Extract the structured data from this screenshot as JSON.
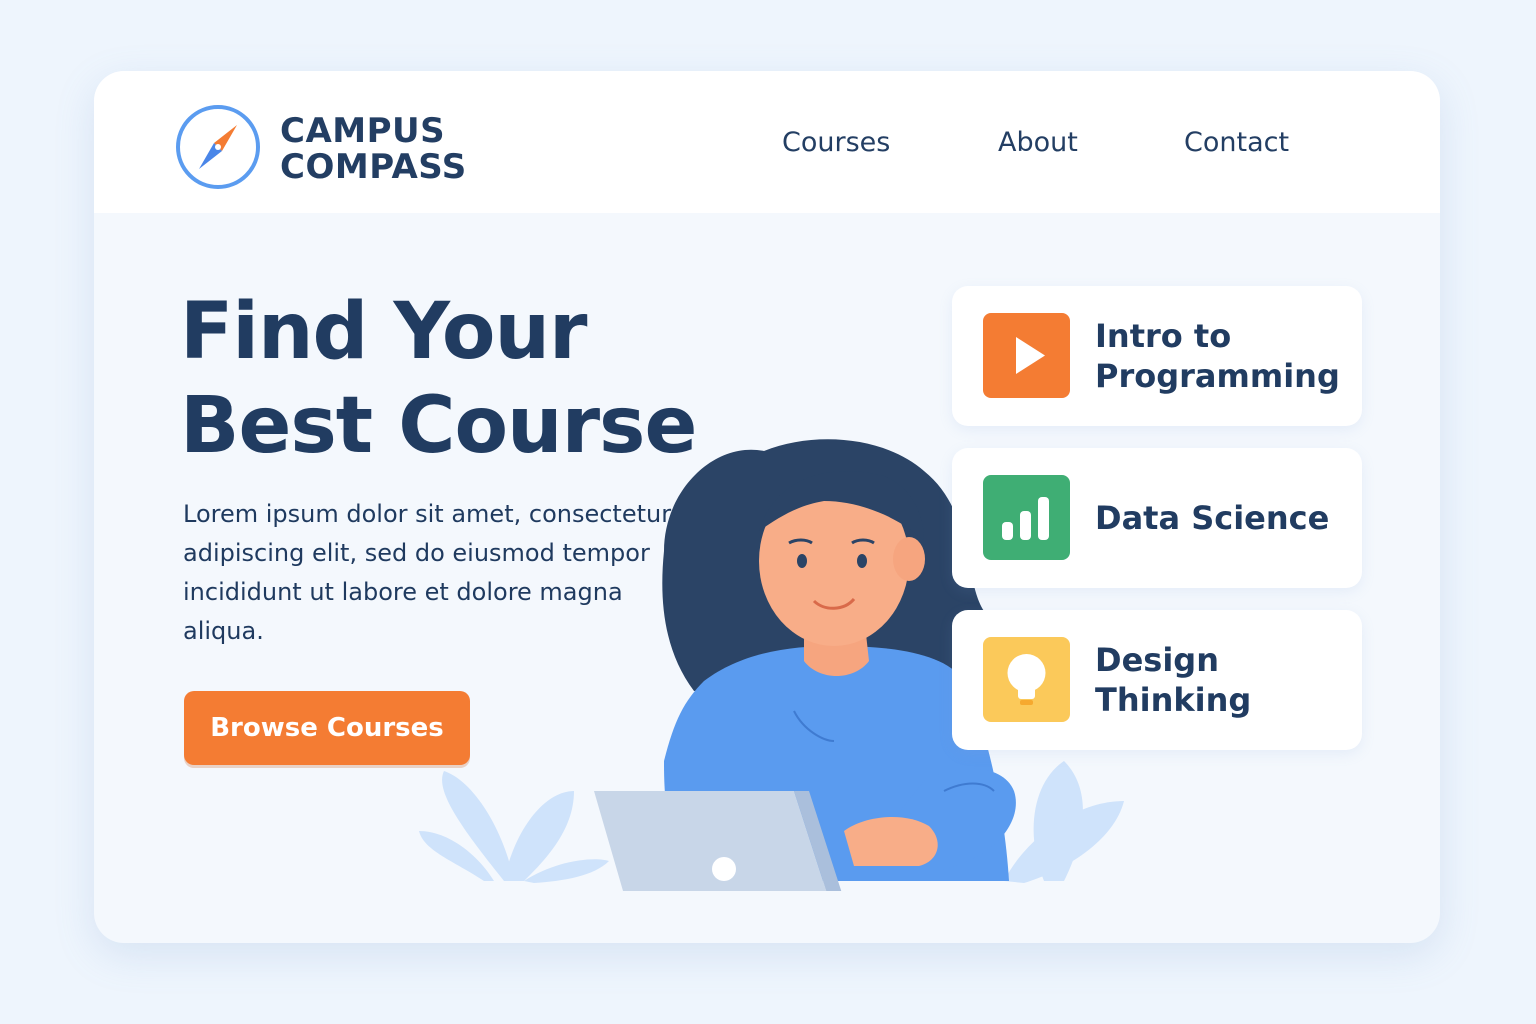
{
  "brand": {
    "line1": "CAMPUS",
    "line2": "COMPASS"
  },
  "nav": [
    {
      "label": "Courses"
    },
    {
      "label": "About"
    },
    {
      "label": "Contact"
    }
  ],
  "hero": {
    "title_line1": "Find Your",
    "title_line2": "Best Course",
    "text": "Lorem ipsum dolor sit amet, consectetur adipiscing elit, sed do eiusmod tempor incididunt ut labore et dolore magna aliqua.",
    "cta_label": "Browse Courses"
  },
  "courses": [
    {
      "label": "Intro to Programming",
      "icon": "play-icon",
      "color": "#f47c33"
    },
    {
      "label": "Data Science",
      "icon": "bar-chart-icon",
      "color": "#3fae74"
    },
    {
      "label": "Design Thinking",
      "icon": "lightbulb-icon",
      "color": "#fbc95a"
    }
  ],
  "colors": {
    "primary": "#213c61",
    "accent": "#f47c33",
    "logo_blue": "#5b9cf0"
  }
}
